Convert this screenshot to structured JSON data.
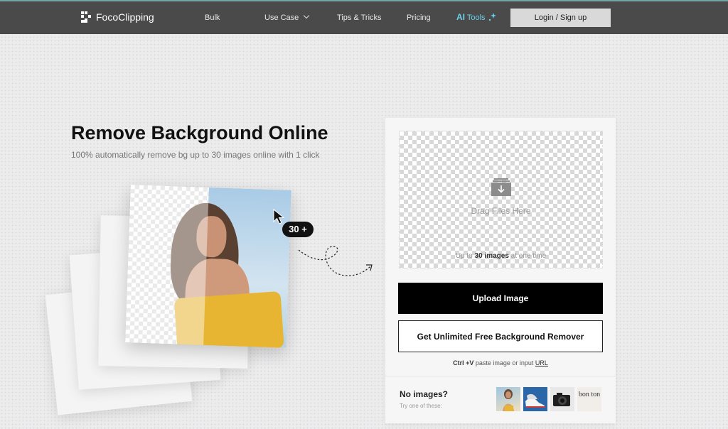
{
  "nav": {
    "brand": "FocoClipping",
    "items": [
      "Bulk",
      "Use Case",
      "Tips & Tricks",
      "Pricing"
    ],
    "ai_prefix": "AI",
    "ai_label": "Tools",
    "login": "Login / Sign up"
  },
  "hero": {
    "title": "Remove Background Online",
    "subtitle": "100% automatically remove bg up to 30 images online with 1 click",
    "badge": "30 +"
  },
  "upload": {
    "drag_text": "Drag Files Here",
    "limit_prefix": "Up to ",
    "limit_bold": "30 images",
    "limit_suffix": " at one time",
    "upload_button": "Upload Image",
    "unlimited_button": "Get Unlimited Free Background Remover",
    "paste_keys": "Ctrl +V",
    "paste_text": " paste image or input ",
    "paste_link": "URL"
  },
  "samples": {
    "title": "No images?",
    "subtitle": "Try one of these:",
    "thumb_text": "bon ton"
  },
  "colors": {
    "nav_bg": "#4a4a4a",
    "ai_accent": "#6fd1ea",
    "primary": "#000000"
  }
}
